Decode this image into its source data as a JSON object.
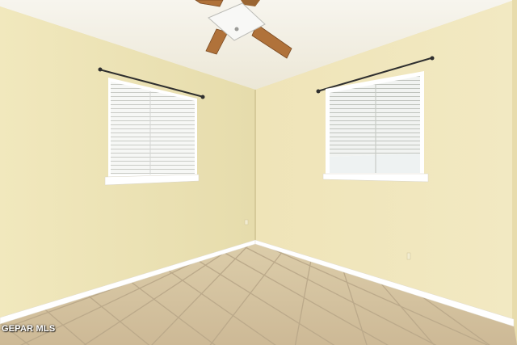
{
  "watermark": {
    "text": "GEPAR MLS"
  },
  "colors": {
    "ceiling": "#f3efe2",
    "left_wall": "#ece2b4",
    "back_wall": "#f0e6bd",
    "floor_tile": "#d7c7a6",
    "grout": "#b9a888",
    "baseboard": "#ffffff",
    "fan_wood": "#b0723a",
    "window_glass": "#f4f6f6",
    "curtain_rod": "#333333"
  }
}
